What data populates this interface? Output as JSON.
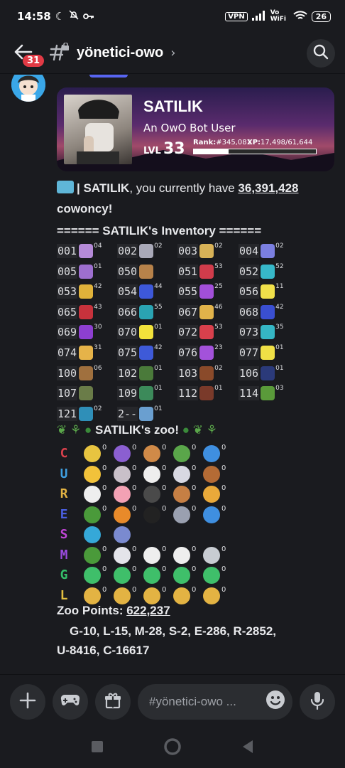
{
  "status": {
    "time": "14:58",
    "vpn": "VPN",
    "network": "Vo WiFi",
    "battery": "26"
  },
  "header": {
    "back_badge": "31",
    "channel": "yönetici-owo"
  },
  "profile_card": {
    "name": "SATILIK",
    "subtitle": "An OwO Bot User",
    "lvl_label": "LVL",
    "level": "33",
    "rank_label": "Rank:",
    "rank": "#345,081",
    "xp_label": "XP:",
    "xp": "17,498/61,644",
    "xp_fraction": 0.284
  },
  "message": {
    "cash_prefix": "| SATILIK",
    "cash_middle": ", you currently have ",
    "cash_amount": "36,391,428",
    "cash_unit": "cowoncy!",
    "inventory_title": "====== SATILIK's Inventory ======"
  },
  "inventory": [
    {
      "code": "001",
      "count": "04",
      "color": "#b58ad8"
    },
    {
      "code": "002",
      "count": "02",
      "color": "#a9a9b8"
    },
    {
      "code": "003",
      "count": "02",
      "color": "#d8b257"
    },
    {
      "code": "004",
      "count": "02",
      "color": "#7b7fe0"
    },
    {
      "code": "005",
      "count": "01",
      "color": "#9d6fcf"
    },
    {
      "code": "050",
      "count": "",
      "color": "#b7824a"
    },
    {
      "code": "051",
      "count": "53",
      "color": "#d13c4b"
    },
    {
      "code": "052",
      "count": "52",
      "color": "#37b8c9"
    },
    {
      "code": "053",
      "count": "42",
      "color": "#e0b23a"
    },
    {
      "code": "054",
      "count": "44",
      "color": "#3d58d9"
    },
    {
      "code": "055",
      "count": "25",
      "color": "#a24fd9"
    },
    {
      "code": "056",
      "count": "11",
      "color": "#f0e04a"
    },
    {
      "code": "065",
      "count": "43",
      "color": "#c7323c"
    },
    {
      "code": "066",
      "count": "55",
      "color": "#2aa3b2"
    },
    {
      "code": "067",
      "count": "46",
      "color": "#e1b34a"
    },
    {
      "code": "068",
      "count": "42",
      "color": "#3a4fd1"
    },
    {
      "code": "069",
      "count": "30",
      "color": "#8d3fd1"
    },
    {
      "code": "070",
      "count": "01",
      "color": "#f2e23b"
    },
    {
      "code": "072",
      "count": "53",
      "color": "#d8404c"
    },
    {
      "code": "073",
      "count": "35",
      "color": "#35b6c4"
    },
    {
      "code": "074",
      "count": "31",
      "color": "#e6b349"
    },
    {
      "code": "075",
      "count": "42",
      "color": "#3e5ad8"
    },
    {
      "code": "076",
      "count": "23",
      "color": "#a352da"
    },
    {
      "code": "077",
      "count": "01",
      "color": "#f0e046"
    },
    {
      "code": "100",
      "count": "06",
      "color": "#a0703e"
    },
    {
      "code": "102",
      "count": "01",
      "color": "#4a7a3a"
    },
    {
      "code": "103",
      "count": "02",
      "color": "#8a4a2a"
    },
    {
      "code": "106",
      "count": "01",
      "color": "#2b3a7a"
    },
    {
      "code": "107",
      "count": "",
      "color": "#6a7c48"
    },
    {
      "code": "109",
      "count": "01",
      "color": "#3c8a5a"
    },
    {
      "code": "112",
      "count": "01",
      "color": "#7a3a2a"
    },
    {
      "code": "114",
      "count": "03",
      "color": "#5a9a3a"
    },
    {
      "code": "121",
      "count": "02",
      "color": "#2f8fb8"
    },
    {
      "code": "2--",
      "count": "01",
      "color": "#6a9fd0"
    }
  ],
  "zoo": {
    "title": "SATILIK's zoo!",
    "rows": [
      {
        "tier": "C",
        "tier_color": "#d9414c",
        "animals": [
          "#e8c440",
          "#8b5fd1",
          "#d08a48",
          "#5aa64a",
          "#3f8fe0"
        ]
      },
      {
        "tier": "U",
        "tier_color": "#3f9fe0",
        "animals": [
          "#f2c23a",
          "#c9c0c9",
          "#eeeeee",
          "#d8d8e2",
          "#b46b35"
        ]
      },
      {
        "tier": "R",
        "tier_color": "#e3b343",
        "animals": [
          "#eeeeee",
          "#f3a1b4",
          "#4a4a4a",
          "#c67f44",
          "#e9a93a"
        ]
      },
      {
        "tier": "E",
        "tier_color": "#4a5fe0",
        "animals": [
          "#4a9a3a",
          "#e88a2a",
          "#222222",
          "#9aa0b0",
          "#3f8fe0"
        ]
      },
      {
        "tier": "S",
        "tier_color": "#c246d8",
        "animals": [
          "#35a8d8",
          "#7a8ad0"
        ]
      },
      {
        "tier": "M",
        "tier_color": "#9a4be0",
        "animals": [
          "#4a9a3a",
          "#e4e4ea",
          "#eeeeee",
          "#eeeeee",
          "#c8ccd2"
        ]
      },
      {
        "tier": "G",
        "tier_color": "#35c06a",
        "animals": [
          "#3fbf6a",
          "#3fbf6a",
          "#3fbf6a",
          "#3fbf6a",
          "#3fbf6a"
        ]
      },
      {
        "tier": "L",
        "tier_color": "#e3c040",
        "animals": [
          "#e3b343",
          "#e3b343",
          "#e3b343",
          "#e3b343",
          "#e3b343"
        ]
      }
    ],
    "animal_count": "0",
    "points_label": "Zoo Points: ",
    "points": "622,237",
    "breakdown_1": "G-10, L-15, M-28, S-2, E-286, R-2852,",
    "breakdown_2": "U-8416, C-16617"
  },
  "input": {
    "placeholder": "#yönetici-owo ..."
  },
  "icons": {
    "back": "arrow-left-icon",
    "channel": "hashtag-lock-icon",
    "search": "search-icon",
    "plus": "plus-icon",
    "games": "gamepad-icon",
    "gift": "gift-icon",
    "emoji": "emoji-icon",
    "mic": "microphone-icon",
    "ticket": "ticket-icon",
    "nav_recents": "square-icon",
    "nav_home": "circle-icon",
    "nav_back": "triangle-back-icon"
  }
}
